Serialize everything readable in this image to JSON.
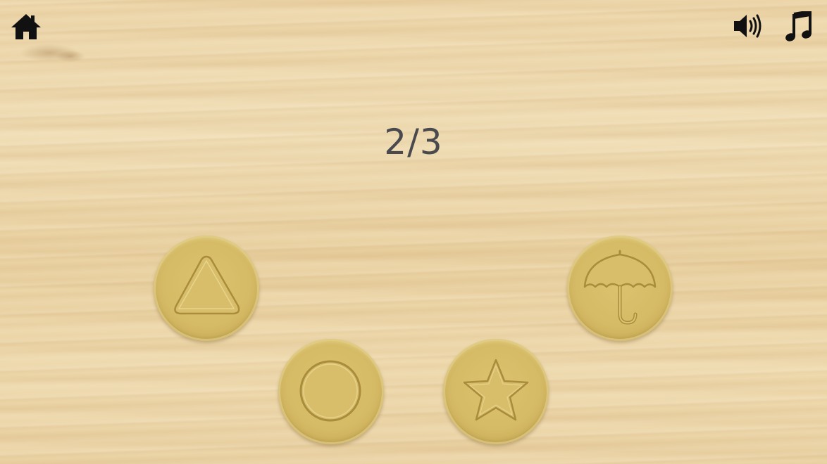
{
  "header": {
    "home_icon": "home-icon",
    "sound_icon": "speaker-volume-icon",
    "music_icon": "music-note-icon"
  },
  "progress": {
    "text": "2/3",
    "current": 2,
    "total": 3
  },
  "tokens": [
    {
      "shape": "triangle"
    },
    {
      "shape": "umbrella"
    },
    {
      "shape": "circle"
    },
    {
      "shape": "star"
    }
  ],
  "colors": {
    "token": "#d6bb66",
    "icon": "#111111",
    "counter_text": "#4a4a4e",
    "wood_background": "#e9d2a4"
  }
}
